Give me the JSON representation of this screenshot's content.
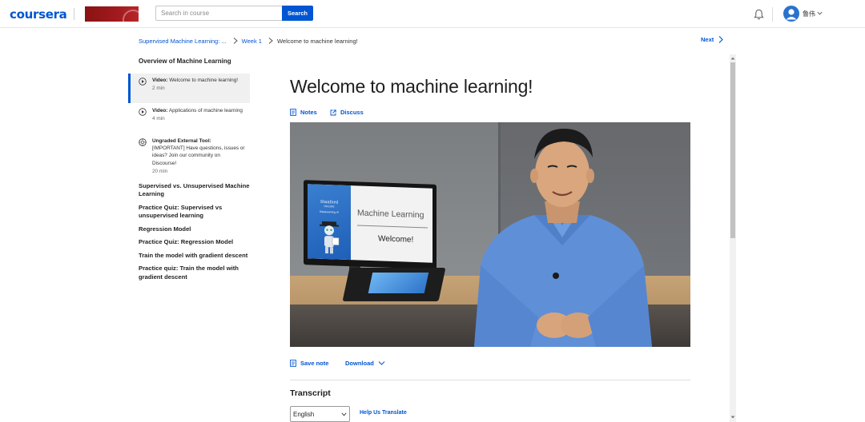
{
  "header": {
    "logo_text": "coursera",
    "search_placeholder": "Search in course",
    "search_button": "Search",
    "username": "鲁伟",
    "icons": [
      "bell-icon",
      "avatar-icon",
      "chevron-down-icon"
    ]
  },
  "breadcrumb": {
    "items": [
      "Supervised Machine Learning: ...",
      "Week 1",
      "Welcome to machine learning!"
    ],
    "next_label": "Next"
  },
  "sidebar": {
    "heading": "Overview of Machine Learning",
    "items": [
      {
        "kind": "Video:",
        "title": "Welcome to machine learning!",
        "duration": "2 min",
        "active": true,
        "icon": "play-circle-icon"
      },
      {
        "kind": "Video:",
        "title": "Applications of machine learning",
        "duration": "4 min",
        "active": false,
        "icon": "play-circle-icon"
      },
      {
        "kind": "Ungraded External Tool:",
        "title": "[IMPORTANT] Have questions, issues or ideas? Join our community on Discourse!",
        "duration": "20 min",
        "active": false,
        "icon": "external-tool-icon"
      }
    ],
    "modules": [
      "Supervised vs. Unsupervised Machine Learning",
      "Practice Quiz: Supervised vs unsupervised learning",
      "Regression Model",
      "Practice Quiz: Regression Model",
      "Train the model with gradient descent",
      "Practice quiz: Train the model with gradient descent"
    ]
  },
  "main": {
    "title": "Welcome to machine learning!",
    "notes_label": "Notes",
    "discuss_label": "Discuss",
    "video": {
      "monitor_brand_1": "Stanford",
      "monitor_brand_2": "ONLINE",
      "monitor_brand_3": "DeepLearning.AI",
      "monitor_title": "Machine Learning",
      "monitor_welcome": "Welcome!"
    },
    "save_note_label": "Save note",
    "download_label": "Download",
    "transcript_title": "Transcript",
    "language_value": "English",
    "help_translate_label": "Help Us Translate"
  },
  "colors": {
    "brand_blue": "#0056d2",
    "partner_red": "#a11a1d"
  }
}
